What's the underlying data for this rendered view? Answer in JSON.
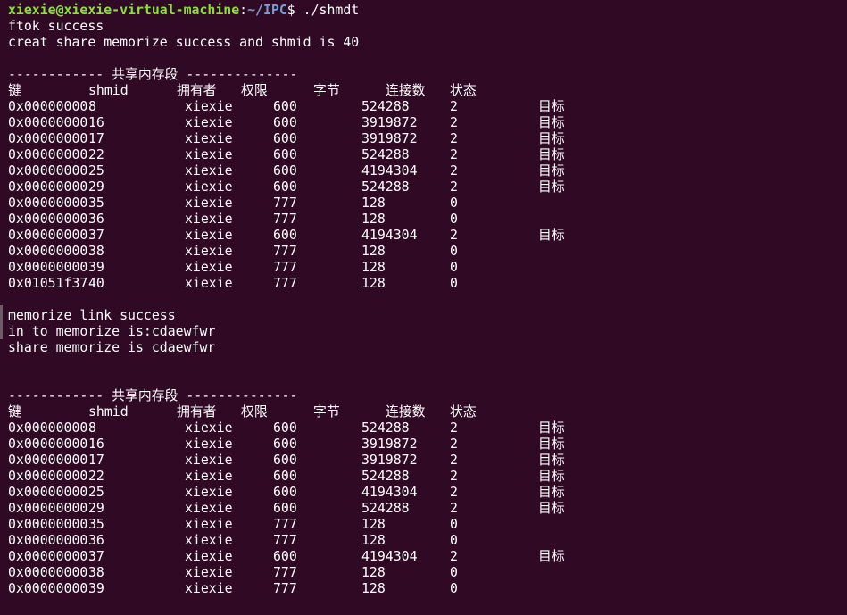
{
  "prompt": {
    "user_host": "xiexie@xiexie-virtual-machine",
    "separator": ":",
    "path": "~/IPC",
    "symbol": "$",
    "command": "./shmdt"
  },
  "output": {
    "ftok_message": "ftok success",
    "creat_message": "creat share memorize success and shmid is 40",
    "link_message": "memorize link success",
    "in_message": "in to memorize is:cdaewfwr",
    "share_message": "share memorize is cdaewfwr"
  },
  "segment_tables": [
    {
      "title": "------------ 共享内存段 --------------",
      "headers": [
        "键",
        "shmid",
        "拥有者",
        "权限",
        "字节",
        "连接数",
        "状态"
      ],
      "rows": [
        [
          "0x00000000",
          "8",
          "xiexie",
          "600",
          "524288",
          "2",
          "目标"
        ],
        [
          "0x00000000",
          "16",
          "xiexie",
          "600",
          "3919872",
          "2",
          "目标"
        ],
        [
          "0x00000000",
          "17",
          "xiexie",
          "600",
          "3919872",
          "2",
          "目标"
        ],
        [
          "0x00000000",
          "22",
          "xiexie",
          "600",
          "524288",
          "2",
          "目标"
        ],
        [
          "0x00000000",
          "25",
          "xiexie",
          "600",
          "4194304",
          "2",
          "目标"
        ],
        [
          "0x00000000",
          "29",
          "xiexie",
          "600",
          "524288",
          "2",
          "目标"
        ],
        [
          "0x00000000",
          "35",
          "xiexie",
          "777",
          "128",
          "0",
          ""
        ],
        [
          "0x00000000",
          "36",
          "xiexie",
          "777",
          "128",
          "0",
          ""
        ],
        [
          "0x00000000",
          "37",
          "xiexie",
          "600",
          "4194304",
          "2",
          "目标"
        ],
        [
          "0x00000000",
          "38",
          "xiexie",
          "777",
          "128",
          "0",
          ""
        ],
        [
          "0x00000000",
          "39",
          "xiexie",
          "777",
          "128",
          "0",
          ""
        ],
        [
          "0x01051f37",
          "40",
          "xiexie",
          "777",
          "128",
          "0",
          ""
        ]
      ]
    },
    {
      "title": "------------ 共享内存段 --------------",
      "headers": [
        "键",
        "shmid",
        "拥有者",
        "权限",
        "字节",
        "连接数",
        "状态"
      ],
      "rows": [
        [
          "0x00000000",
          "8",
          "xiexie",
          "600",
          "524288",
          "2",
          "目标"
        ],
        [
          "0x00000000",
          "16",
          "xiexie",
          "600",
          "3919872",
          "2",
          "目标"
        ],
        [
          "0x00000000",
          "17",
          "xiexie",
          "600",
          "3919872",
          "2",
          "目标"
        ],
        [
          "0x00000000",
          "22",
          "xiexie",
          "600",
          "524288",
          "2",
          "目标"
        ],
        [
          "0x00000000",
          "25",
          "xiexie",
          "600",
          "4194304",
          "2",
          "目标"
        ],
        [
          "0x00000000",
          "29",
          "xiexie",
          "600",
          "524288",
          "2",
          "目标"
        ],
        [
          "0x00000000",
          "35",
          "xiexie",
          "777",
          "128",
          "0",
          ""
        ],
        [
          "0x00000000",
          "36",
          "xiexie",
          "777",
          "128",
          "0",
          ""
        ],
        [
          "0x00000000",
          "37",
          "xiexie",
          "600",
          "4194304",
          "2",
          "目标"
        ],
        [
          "0x00000000",
          "38",
          "xiexie",
          "777",
          "128",
          "0",
          ""
        ],
        [
          "0x00000000",
          "39",
          "xiexie",
          "777",
          "128",
          "0",
          ""
        ]
      ]
    }
  ],
  "colors": {
    "background": "#300a24",
    "text": "#ffffff",
    "prompt_user": "#8ae234",
    "prompt_path": "#729fcf"
  }
}
